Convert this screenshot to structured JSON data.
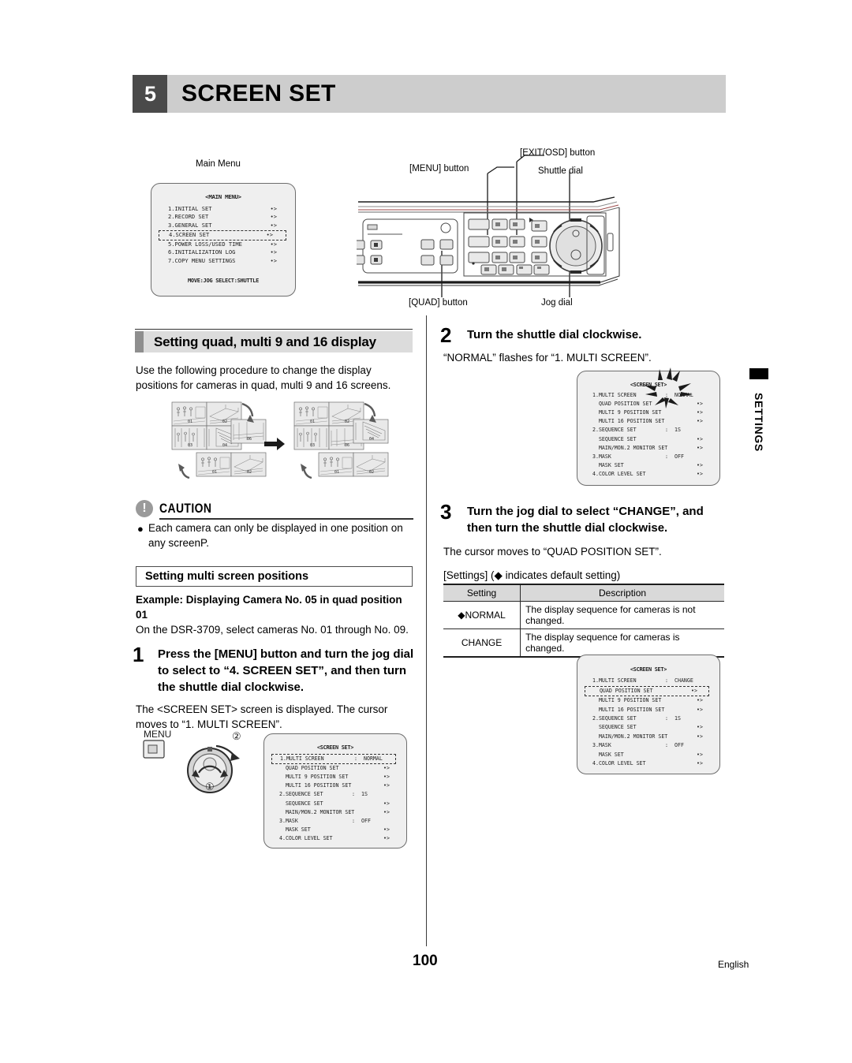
{
  "chapter": {
    "number": "5",
    "title": "SCREEN SET"
  },
  "callouts": {
    "main_menu": "Main Menu",
    "menu_button": "[MENU] button",
    "exit_osd_button": "[EXIT/OSD] button",
    "shuttle_dial": "Shuttle dial",
    "quad_button": "[QUAD] button",
    "jog_dial": "Jog dial"
  },
  "main_menu_osd": {
    "title": "<MAIN MENU>",
    "rows": [
      {
        "label": "1.INITIAL SET",
        "value": "•>"
      },
      {
        "label": "2.RECORD SET",
        "value": "•>"
      },
      {
        "label": "3.GENERAL SET",
        "value": "•>"
      },
      {
        "label": "4.SCREEN SET",
        "value": "•>"
      },
      {
        "label": "5.POWER LOSS/USED TIME",
        "value": "•>"
      },
      {
        "label": "6.INITIALIZATION LOG",
        "value": "•>"
      },
      {
        "label": "7.COPY MENU SETTINGS",
        "value": "•>"
      }
    ],
    "footer": "MOVE:JOG   SELECT:SHUTTLE",
    "highlight_row": 3
  },
  "section": {
    "heading": "Setting quad, multi 9 and 16 display",
    "intro": "Use the following procedure to change the display positions for cameras in quad, multi 9 and 16 screens."
  },
  "caution": {
    "label": "CAUTION",
    "icon": "!",
    "text": "Each camera can only be displayed in one position on any screenP."
  },
  "multi_screen_positions": {
    "heading": "Setting multi screen positions",
    "example": "Example: Displaying Camera No. 05 in quad position 01",
    "note": "On the DSR-3709, select cameras No. 01 through No. 09.",
    "tile_labels_before": [
      "01",
      "02",
      "03",
      "04",
      "06",
      "01",
      "02"
    ],
    "tile_labels_after": [
      "01",
      "02",
      "03",
      "04",
      "06",
      "01",
      "02"
    ]
  },
  "steps": [
    {
      "num": "1",
      "title": "Press the [MENU] button and turn the jog dial to select to “4. SCREEN SET”, and then turn the shuttle dial clockwise.",
      "desc": "The <SCREEN SET> screen is displayed. The cursor moves to “1. MULTI SCREEN”."
    },
    {
      "num": "2",
      "title": "Turn the shuttle dial clockwise.",
      "desc": "“NORMAL” flashes for “1. MULTI SCREEN”."
    },
    {
      "num": "3",
      "title": "Turn the jog dial to select “CHANGE”, and then turn the shuttle dial clockwise.",
      "desc": "The cursor moves to “QUAD POSITION SET”."
    }
  ],
  "dial_diagram": {
    "menu_label": "MENU",
    "marker_1": "①",
    "marker_2": "②"
  },
  "screen_set_osd": {
    "title": "<SCREEN SET>",
    "rows": [
      {
        "label": "1.MULTI SCREEN",
        "sep": ":",
        "value": "NORMAL"
      },
      {
        "label": "  QUAD POSITION SET",
        "sep": "",
        "value": "•>"
      },
      {
        "label": "  MULTI 9 POSITION SET",
        "sep": "",
        "value": "•>"
      },
      {
        "label": "  MULTI 16 POSITION SET",
        "sep": "",
        "value": "•>"
      },
      {
        "label": "2.SEQUENCE SET",
        "sep": ":",
        "value": "1S"
      },
      {
        "label": "  SEQUENCE SET",
        "sep": "",
        "value": "•>"
      },
      {
        "label": "  MAIN/MON.2 MONITOR SET",
        "sep": "",
        "value": "•>"
      },
      {
        "label": "3.MASK",
        "sep": ":",
        "value": "OFF"
      },
      {
        "label": "  MASK SET",
        "sep": "",
        "value": "•>"
      },
      {
        "label": "4.COLOR LEVEL SET",
        "sep": "",
        "value": "•>"
      }
    ]
  },
  "screen_set_osd_change": {
    "title": "<SCREEN SET>",
    "rows": [
      {
        "label": "1.MULTI SCREEN",
        "sep": ":",
        "value": "CHANGE"
      },
      {
        "label": "  QUAD POSITION SET",
        "sep": "",
        "value": "•>"
      },
      {
        "label": "  MULTI 9 POSITION SET",
        "sep": "",
        "value": "•>"
      },
      {
        "label": "  MULTI 16 POSITION SET",
        "sep": "",
        "value": "•>"
      },
      {
        "label": "2.SEQUENCE SET",
        "sep": ":",
        "value": "1S"
      },
      {
        "label": "  SEQUENCE SET",
        "sep": "",
        "value": "•>"
      },
      {
        "label": "  MAIN/MON.2 MONITOR SET",
        "sep": "",
        "value": "•>"
      },
      {
        "label": "3.MASK",
        "sep": ":",
        "value": "OFF"
      },
      {
        "label": "  MASK SET",
        "sep": "",
        "value": "•>"
      },
      {
        "label": "4.COLOR LEVEL SET",
        "sep": "",
        "value": "•>"
      }
    ]
  },
  "settings_table": {
    "caption": "[Settings] (◆ indicates default setting)",
    "headers": [
      "Setting",
      "Description"
    ],
    "rows": [
      {
        "setting": "◆NORMAL",
        "description": "The display sequence for cameras is not changed."
      },
      {
        "setting": "CHANGE",
        "description": "The display sequence for cameras is changed."
      }
    ]
  },
  "side_tab": {
    "label": "SETTINGS"
  },
  "footer": {
    "page": "100",
    "language": "English"
  }
}
